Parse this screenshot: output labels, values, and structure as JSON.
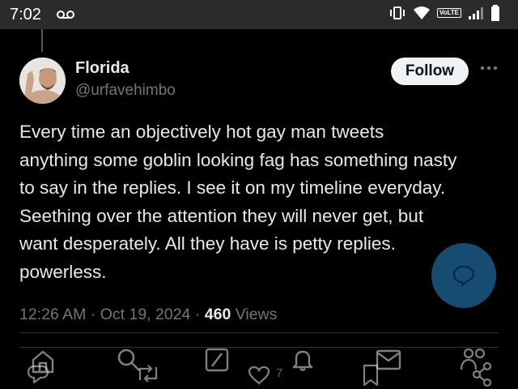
{
  "status_bar": {
    "time": "7:02",
    "network_badge": "VoLTE"
  },
  "tweet": {
    "author_name": "Florida",
    "author_handle": "@urfavehimbo",
    "follow_label": "Follow",
    "text_lines": [
      "Every time an objectively hot gay man tweets",
      "anything some goblin looking fag has something nasty",
      "to say in the replies. I see it on my timeline everyday.",
      "Seething over the attention they will never get, but",
      "want desperately. All they have is petty replies.",
      "powerless."
    ],
    "time": "12:26 AM",
    "date": "Oct 19, 2024",
    "views_count": "460",
    "views_label": "Views"
  },
  "actions": {
    "like_count": "7"
  },
  "icons": {
    "more": "more-options-icon",
    "reply": "reply-icon",
    "retweet": "retweet-icon",
    "like": "heart-icon",
    "bookmark": "bookmark-icon",
    "share": "share-icon",
    "home": "home-icon",
    "search": "search-icon",
    "grok": "grok-icon",
    "notifications": "bell-icon",
    "messages": "mail-icon",
    "communities": "communities-icon",
    "compose": "compose-icon"
  },
  "colors": {
    "background": "#000000",
    "text": "#e7e9ea",
    "muted": "#71767b",
    "fab": "#1d5d8c"
  }
}
